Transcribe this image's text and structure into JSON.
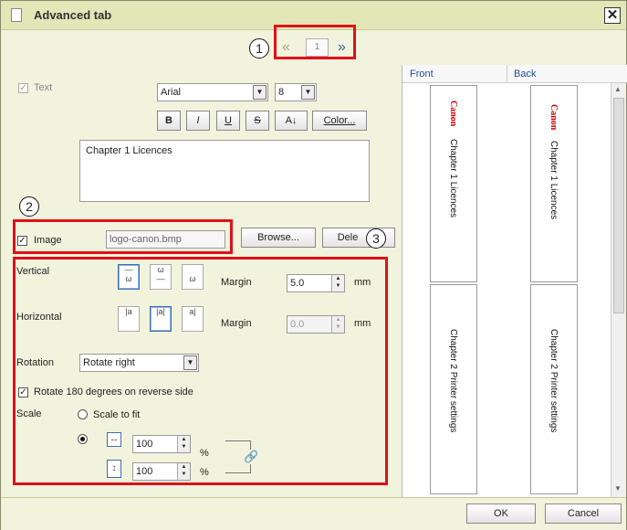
{
  "window": {
    "title": "Advanced tab"
  },
  "pager": {
    "current_page": "1",
    "prev_icon": "chevron-left-icon",
    "next_icon": "chevron-right-icon"
  },
  "callouts": [
    "1",
    "2",
    "3"
  ],
  "text_section": {
    "checkbox_label": "Text",
    "font": "Arial",
    "font_size": "8",
    "bold": "B",
    "italic": "I",
    "underline": "U",
    "strike": "S",
    "direction": "A↓",
    "color_button": "Color...",
    "content": "Chapter 1 Licences"
  },
  "image_section": {
    "checkbox_label": "Image",
    "file_name": "logo-canon.bmp",
    "browse_button": "Browse...",
    "delete_button": "Dele"
  },
  "position": {
    "vertical_label": "Vertical",
    "horizontal_label": "Horizontal",
    "margin_label": "Margin",
    "vertical_margin": "5.0",
    "horizontal_margin": "0.0",
    "unit_mm": "mm"
  },
  "rotation": {
    "label": "Rotation",
    "value": "Rotate right",
    "reverse_label": "Rotate 180 degrees on reverse side"
  },
  "scale": {
    "label": "Scale",
    "fit_label": "Scale to fit",
    "width_value": "100",
    "height_value": "100",
    "unit_percent": "%"
  },
  "preview": {
    "front_label": "Front",
    "back_label": "Back",
    "logo_text": "Canon",
    "tab1_text": "Chapter 1 Licences",
    "tab2_text": "Chapter 2 Printer settings"
  },
  "footer": {
    "ok_button": "OK",
    "cancel_button": "Cancel"
  },
  "colors": {
    "accent_red": "#e0101a",
    "canon_red": "#cc0000",
    "panel_bg": "#f1f3dc"
  }
}
